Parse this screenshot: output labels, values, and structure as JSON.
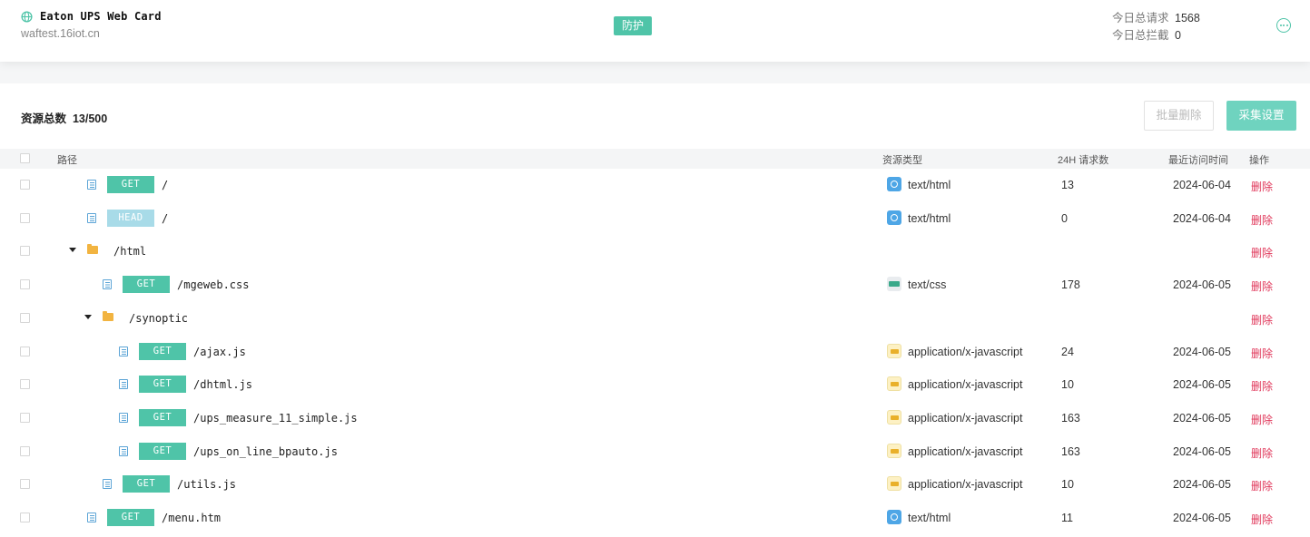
{
  "header": {
    "site_title": "Eaton UPS Web Card",
    "site_domain": "waftest.16iot.cn",
    "status_badge": "防护",
    "stats": [
      {
        "label": "今日总请求",
        "value": "1568"
      },
      {
        "label": "今日总拦截",
        "value": "0"
      }
    ]
  },
  "toolbar": {
    "resource_count_label": "资源总数",
    "resource_count_value": "13/500",
    "batch_delete_label": "批量删除",
    "collect_settings_label": "采集设置"
  },
  "table": {
    "columns": {
      "path": "路径",
      "type": "资源类型",
      "requests": "24H 请求数",
      "last_visit": "最近访问时间",
      "action": "操作"
    },
    "delete_label": "删除",
    "rows": [
      {
        "kind": "file",
        "method": "GET",
        "path": "/",
        "type": "text/html",
        "type_icon": "html-icon",
        "requests": "13",
        "last_visit": "2024-06-04"
      },
      {
        "kind": "file",
        "method": "HEAD",
        "path": "/",
        "type": "text/html",
        "type_icon": "html-icon",
        "requests": "0",
        "last_visit": "2024-06-04"
      },
      {
        "kind": "folder",
        "path": "/html"
      },
      {
        "kind": "file",
        "method": "GET",
        "path": "/mgeweb.css",
        "type": "text/css",
        "type_icon": "css-icon",
        "requests": "178",
        "last_visit": "2024-06-05"
      },
      {
        "kind": "folder",
        "path": "/synoptic"
      },
      {
        "kind": "file",
        "method": "GET",
        "path": "/ajax.js",
        "type": "application/x-javascript",
        "type_icon": "js-icon",
        "requests": "24",
        "last_visit": "2024-06-05"
      },
      {
        "kind": "file",
        "method": "GET",
        "path": "/dhtml.js",
        "type": "application/x-javascript",
        "type_icon": "js-icon",
        "requests": "10",
        "last_visit": "2024-06-05"
      },
      {
        "kind": "file",
        "method": "GET",
        "path": "/ups_measure_11_simple.js",
        "type": "application/x-javascript",
        "type_icon": "js-icon",
        "requests": "163",
        "last_visit": "2024-06-05"
      },
      {
        "kind": "file",
        "method": "GET",
        "path": "/ups_on_line_bpauto.js",
        "type": "application/x-javascript",
        "type_icon": "js-icon",
        "requests": "163",
        "last_visit": "2024-06-05"
      },
      {
        "kind": "file",
        "method": "GET",
        "path": "/utils.js",
        "type": "application/x-javascript",
        "type_icon": "js-icon",
        "requests": "10",
        "last_visit": "2024-06-05"
      },
      {
        "kind": "file",
        "method": "GET",
        "path": "/menu.htm",
        "type": "text/html",
        "type_icon": "html-icon",
        "requests": "11",
        "last_visit": "2024-06-05"
      }
    ]
  },
  "colors": {
    "accent": "#4fc4a8",
    "delete": "#e0375a",
    "head_method": "#a8dbe8"
  }
}
